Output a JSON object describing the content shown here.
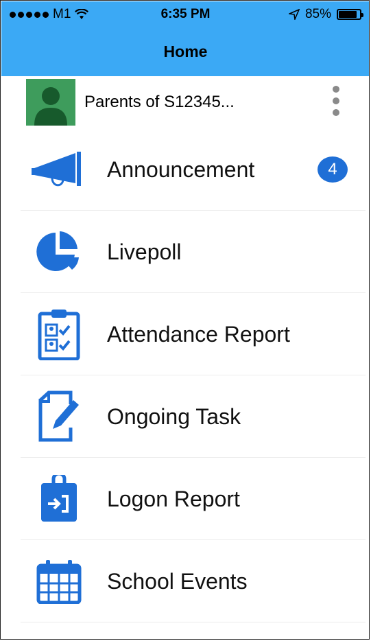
{
  "status_bar": {
    "carrier": "M1",
    "time": "6:35 PM",
    "battery_percent": "85%",
    "battery_level": 0.85
  },
  "header": {
    "title": "Home"
  },
  "profile": {
    "name": "Parents of S12345..."
  },
  "menu": {
    "items": [
      {
        "label": "Announcement",
        "icon": "megaphone-icon",
        "badge": "4"
      },
      {
        "label": "Livepoll",
        "icon": "pie-chart-icon"
      },
      {
        "label": "Attendance Report",
        "icon": "clipboard-checklist-icon"
      },
      {
        "label": "Ongoing Task",
        "icon": "document-edit-icon"
      },
      {
        "label": "Logon Report",
        "icon": "clipboard-login-icon"
      },
      {
        "label": "School Events",
        "icon": "calendar-icon"
      }
    ]
  },
  "colors": {
    "header_bg": "#3BA9F5",
    "icon_blue": "#1F6FD6",
    "avatar_bg": "#3E9C5C"
  }
}
